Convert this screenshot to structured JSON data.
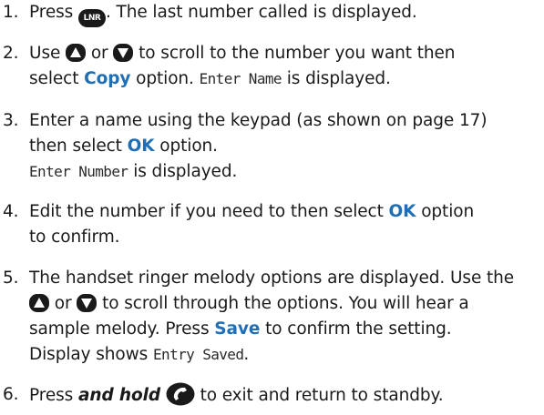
{
  "icons": {
    "lnr": "LNR",
    "up": "up-arrow-icon",
    "down": "down-arrow-icon",
    "end_call": "end-call-icon"
  },
  "steps": [
    {
      "num": "1.",
      "a": "Press",
      "b": ". The last number called is displayed."
    },
    {
      "num": "2.",
      "a": "Use",
      "b": "or",
      "c": "to scroll to the number you want then",
      "d": "select",
      "e": "Copy",
      "f": "option.",
      "g": "Enter Name",
      "h": "is displayed."
    },
    {
      "num": "3.",
      "a": "Enter a name using the keypad (as shown on page 17)",
      "b": "then select",
      "c": "OK",
      "d": "option.",
      "e": "Enter Number",
      "f": "is displayed."
    },
    {
      "num": "4.",
      "a": "Edit the number if you need to then select",
      "b": "OK",
      "c": "option",
      "d": "to confirm."
    },
    {
      "num": "5.",
      "a": "The handset ringer melody options are displayed. Use the",
      "b": "or",
      "c": "to scroll through the options. You will hear a",
      "d": "sample melody. Press",
      "e": "Save",
      "f": "to confirm the setting.",
      "g": "Display shows",
      "h": "Entry Saved",
      "i": "."
    },
    {
      "num": "6.",
      "a": "Press",
      "b": "and hold",
      "c": "to exit and return to standby."
    }
  ]
}
